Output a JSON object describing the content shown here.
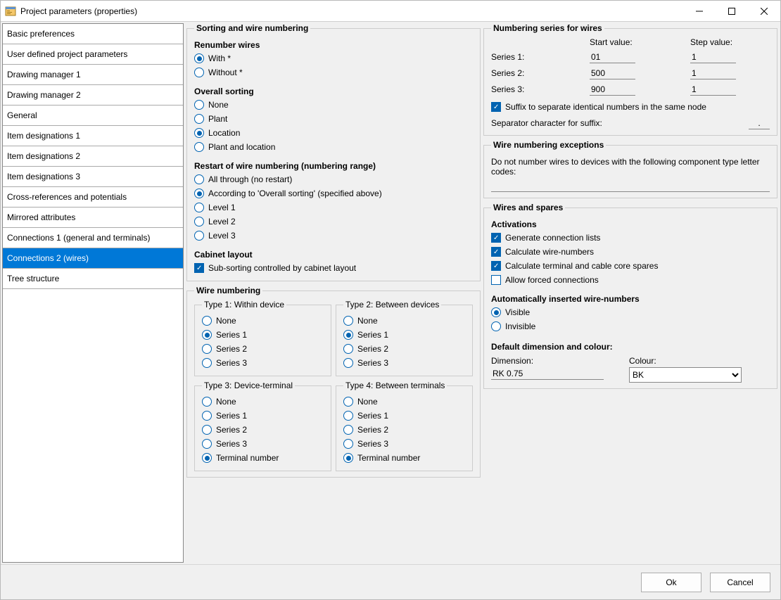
{
  "window": {
    "title": "Project parameters (properties)"
  },
  "sidebar": {
    "items": [
      {
        "label": "Basic preferences"
      },
      {
        "label": "User defined project parameters"
      },
      {
        "label": "Drawing manager 1"
      },
      {
        "label": "Drawing manager 2"
      },
      {
        "label": "General"
      },
      {
        "label": "Item designations 1"
      },
      {
        "label": "Item designations 2"
      },
      {
        "label": "Item designations 3"
      },
      {
        "label": "Cross-references and potentials"
      },
      {
        "label": "Mirrored attributes"
      },
      {
        "label": "Connections 1 (general and terminals)"
      },
      {
        "label": "Connections 2 (wires)",
        "selected": true
      },
      {
        "label": "Tree structure"
      }
    ]
  },
  "sorting": {
    "group_title": "Sorting and wire numbering",
    "renumber": {
      "title": "Renumber wires",
      "options": [
        "With *",
        "Without *"
      ],
      "value": "With *"
    },
    "overall": {
      "title": "Overall sorting",
      "options": [
        "None",
        "Plant",
        "Location",
        "Plant and location"
      ],
      "value": "Location"
    },
    "restart": {
      "title": "Restart of wire numbering (numbering range)",
      "options": [
        "All through (no restart)",
        "According to 'Overall sorting' (specified above)",
        "Level 1",
        "Level 2",
        "Level 3"
      ],
      "value": "According to 'Overall sorting' (specified above)"
    },
    "cabinet": {
      "title": "Cabinet layout",
      "label": "Sub-sorting controlled by cabinet layout",
      "checked": true
    }
  },
  "wirenum": {
    "group_title": "Wire numbering",
    "types": [
      {
        "title": "Type 1: Within device",
        "options": [
          "None",
          "Series 1",
          "Series 2",
          "Series 3"
        ],
        "value": "Series 1"
      },
      {
        "title": "Type 2: Between devices",
        "options": [
          "None",
          "Series 1",
          "Series 2",
          "Series 3"
        ],
        "value": "Series 1"
      },
      {
        "title": "Type 3: Device-terminal",
        "options": [
          "None",
          "Series 1",
          "Series 2",
          "Series 3",
          "Terminal number"
        ],
        "value": "Terminal number"
      },
      {
        "title": "Type 4: Between terminals",
        "options": [
          "None",
          "Series 1",
          "Series 2",
          "Series 3",
          "Terminal number"
        ],
        "value": "Terminal number"
      }
    ]
  },
  "series": {
    "group_title": "Numbering series for wires",
    "col_start": "Start value:",
    "col_step": "Step value:",
    "rows": [
      {
        "label": "Series 1:",
        "start": "01",
        "step": "1"
      },
      {
        "label": "Series 2:",
        "start": "500",
        "step": "1"
      },
      {
        "label": "Series 3:",
        "start": "900",
        "step": "1"
      }
    ],
    "suffix_check": {
      "label": "Suffix to separate identical numbers in the same node",
      "checked": true
    },
    "sep_label": "Separator character for suffix:",
    "sep_value": "."
  },
  "exceptions": {
    "group_title": "Wire numbering exceptions",
    "desc": "Do not number wires to devices with the following component type letter codes:",
    "value": ""
  },
  "spares": {
    "group_title": "Wires and spares",
    "activations": {
      "title": "Activations",
      "items": [
        {
          "label": "Generate connection lists",
          "checked": true
        },
        {
          "label": "Calculate wire-numbers",
          "checked": true
        },
        {
          "label": "Calculate terminal and cable core spares",
          "checked": true
        },
        {
          "label": "Allow forced connections",
          "checked": false
        }
      ]
    },
    "auto": {
      "title": "Automatically inserted wire-numbers",
      "options": [
        "Visible",
        "Invisible"
      ],
      "value": "Visible"
    },
    "dim": {
      "title": "Default dimension and colour:",
      "dimension_label": "Dimension:",
      "dimension_value": "RK 0.75",
      "colour_label": "Colour:",
      "colour_value": "BK"
    }
  },
  "footer": {
    "ok": "Ok",
    "cancel": "Cancel"
  }
}
